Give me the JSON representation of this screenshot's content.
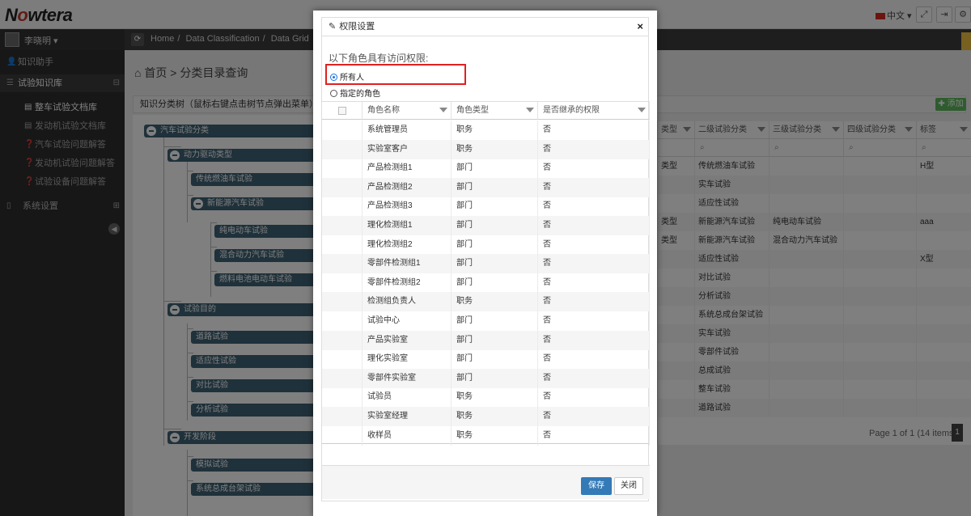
{
  "header": {
    "logo_text_pre": "N",
    "logo_text_o": "o",
    "logo_text_post": "wtera",
    "language": "中文"
  },
  "sidebar": {
    "user_name": "李晓明",
    "items": [
      {
        "label": "知识助手",
        "icon": "user-icon"
      },
      {
        "label": "试验知识库",
        "icon": "list-icon"
      },
      {
        "label": "系统设置",
        "icon": "mobile-icon"
      }
    ],
    "subitems": [
      {
        "label": "整车试验文档库",
        "icon": "doc-icon"
      },
      {
        "label": "发动机试验文档库",
        "icon": "doc-icon"
      },
      {
        "label": "汽车试验问题解答",
        "icon": "question-icon"
      },
      {
        "label": "发动机试验问题解答",
        "icon": "question-icon"
      },
      {
        "label": "试验设备问题解答",
        "icon": "question-icon"
      }
    ]
  },
  "breadcrumb": [
    "Home",
    "Data Classification",
    "Data Grid"
  ],
  "page": {
    "title": "首页 > 分类目录查询",
    "tree_panel_title": "知识分类树（鼠标右键点击树节点弹出菜单）",
    "add_button": "添加"
  },
  "tree": {
    "root": "汽车试验分类",
    "groups": [
      {
        "label": "动力驱动类型",
        "children": [
          "传统燃油车试验",
          "新能源汽车试验"
        ]
      },
      {
        "label": "试验目的",
        "children": [
          "道路试验",
          "适应性试验",
          "对比试验",
          "分析试验"
        ]
      },
      {
        "label": "开发阶段",
        "children": [
          "模拟试验",
          "系统总成台架试验"
        ]
      }
    ],
    "new_energy_children": [
      "纯电动车试验",
      "混合动力汽车试验",
      "燃料电池电动车试验"
    ]
  },
  "grid": {
    "columns": [
      "类型",
      "二级试验分类",
      "三级试验分类",
      "四级试验分类",
      "标签"
    ],
    "rows": [
      [
        "类型",
        "传统燃油车试验",
        "",
        "",
        "H型"
      ],
      [
        "",
        "实车试验",
        "",
        "",
        ""
      ],
      [
        "",
        "适应性试验",
        "",
        "",
        ""
      ],
      [
        "类型",
        "新能源汽车试验",
        "纯电动车试验",
        "",
        "aaa"
      ],
      [
        "类型",
        "新能源汽车试验",
        "混合动力汽车试验",
        "",
        ""
      ],
      [
        "",
        "适应性试验",
        "",
        "",
        "X型"
      ],
      [
        "",
        "对比试验",
        "",
        "",
        ""
      ],
      [
        "",
        "分析试验",
        "",
        "",
        ""
      ],
      [
        "",
        "系统总成台架试验",
        "",
        "",
        ""
      ],
      [
        "",
        "实车试验",
        "",
        "",
        ""
      ],
      [
        "",
        "零部件试验",
        "",
        "",
        ""
      ],
      [
        "",
        "总成试验",
        "",
        "",
        ""
      ],
      [
        "",
        "整车试验",
        "",
        "",
        ""
      ],
      [
        "",
        "道路试验",
        "",
        "",
        ""
      ]
    ],
    "pager": "Page 1 of 1 (14 items)",
    "page_number": "1"
  },
  "modal": {
    "title": "权限设置",
    "access_label": "以下角色具有访问权限:",
    "radio_all": "所有人",
    "radio_specified": "指定的角色",
    "columns": [
      "角色名称",
      "角色类型",
      "是否继承的权限"
    ],
    "rows": [
      [
        "系统管理员",
        "职务",
        "否"
      ],
      [
        "实验室客户",
        "职务",
        "否"
      ],
      [
        "产品检测组1",
        "部门",
        "否"
      ],
      [
        "产品检测组2",
        "部门",
        "否"
      ],
      [
        "产品检测组3",
        "部门",
        "否"
      ],
      [
        "理化检测组1",
        "部门",
        "否"
      ],
      [
        "理化检测组2",
        "部门",
        "否"
      ],
      [
        "零部件检测组1",
        "部门",
        "否"
      ],
      [
        "零部件检测组2",
        "部门",
        "否"
      ],
      [
        "检测组负责人",
        "职务",
        "否"
      ],
      [
        "试验中心",
        "部门",
        "否"
      ],
      [
        "产品实验室",
        "部门",
        "否"
      ],
      [
        "理化实验室",
        "部门",
        "否"
      ],
      [
        "零部件实验室",
        "部门",
        "否"
      ],
      [
        "试验员",
        "职务",
        "否"
      ],
      [
        "实验室经理",
        "职务",
        "否"
      ],
      [
        "收样员",
        "职务",
        "否"
      ]
    ],
    "save_label": "保存",
    "close_label": "关闭"
  },
  "colors": {
    "accent_red": "#e02020",
    "primary_blue": "#337ab7",
    "tree_node": "#3e6275",
    "sidebar_bg": "#2f2f2f"
  }
}
